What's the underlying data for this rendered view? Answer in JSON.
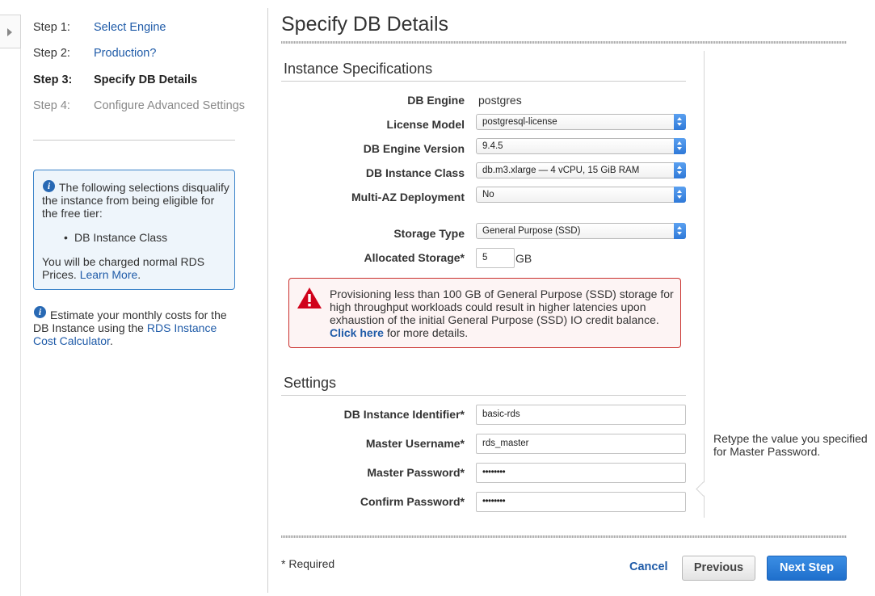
{
  "wizard": {
    "steps": [
      {
        "num": "Step 1:",
        "name": "Select Engine",
        "state": "link"
      },
      {
        "num": "Step 2:",
        "name": "Production?",
        "state": "link"
      },
      {
        "num": "Step 3:",
        "name": "Specify DB Details",
        "state": "current"
      },
      {
        "num": "Step 4:",
        "name": "Configure Advanced Settings",
        "state": "disabled"
      }
    ]
  },
  "free_tier_box": {
    "text": "The following selections disqualify the instance from being eligible for the free tier:",
    "bullet": "DB Instance Class",
    "charge_text": "You will be charged normal RDS Prices.",
    "learn_more": "Learn More",
    "period": "."
  },
  "estimate": {
    "text": "Estimate your monthly costs for the DB Instance using the",
    "link": "RDS Instance Cost Calculator",
    "period": "."
  },
  "page_title": "Specify DB Details",
  "instance_specs": {
    "section_title": "Instance Specifications",
    "db_engine_label": "DB Engine",
    "db_engine_value": "postgres",
    "license_model_label": "License Model",
    "license_model_value": "postgresql-license",
    "engine_version_label": "DB Engine Version",
    "engine_version_value": "9.4.5",
    "instance_class_label": "DB Instance Class",
    "instance_class_value": "db.m3.xlarge — 4 vCPU, 15 GiB RAM",
    "multi_az_label": "Multi-AZ Deployment",
    "multi_az_value": "No",
    "storage_type_label": "Storage Type",
    "storage_type_value": "General Purpose (SSD)",
    "allocated_storage_label": "Allocated Storage*",
    "allocated_storage_value": "5",
    "allocated_storage_unit": "GB"
  },
  "warning": {
    "text": "Provisioning less than 100 GB of General Purpose (SSD) storage for high throughput workloads could result in higher latencies upon exhaustion of the initial General Purpose (SSD) IO credit balance.",
    "link": "Click here",
    "suffix": "for more details."
  },
  "settings": {
    "section_title": "Settings",
    "identifier_label": "DB Instance Identifier*",
    "identifier_value": "basic-rds",
    "username_label": "Master Username*",
    "username_value": "rds_master",
    "password_label": "Master Password*",
    "password_value": "••••••••",
    "confirm_label": "Confirm Password*",
    "confirm_value": "••••••••"
  },
  "tooltip": "Retype the value you specified for Master Password.",
  "footer": {
    "required_note": "* Required",
    "cancel": "Cancel",
    "previous": "Previous",
    "next": "Next Step"
  },
  "colors": {
    "link": "#1f5ba8",
    "primary_button": "#2576d3",
    "warning_border": "#c9302c",
    "info_border": "#3b83c9"
  }
}
